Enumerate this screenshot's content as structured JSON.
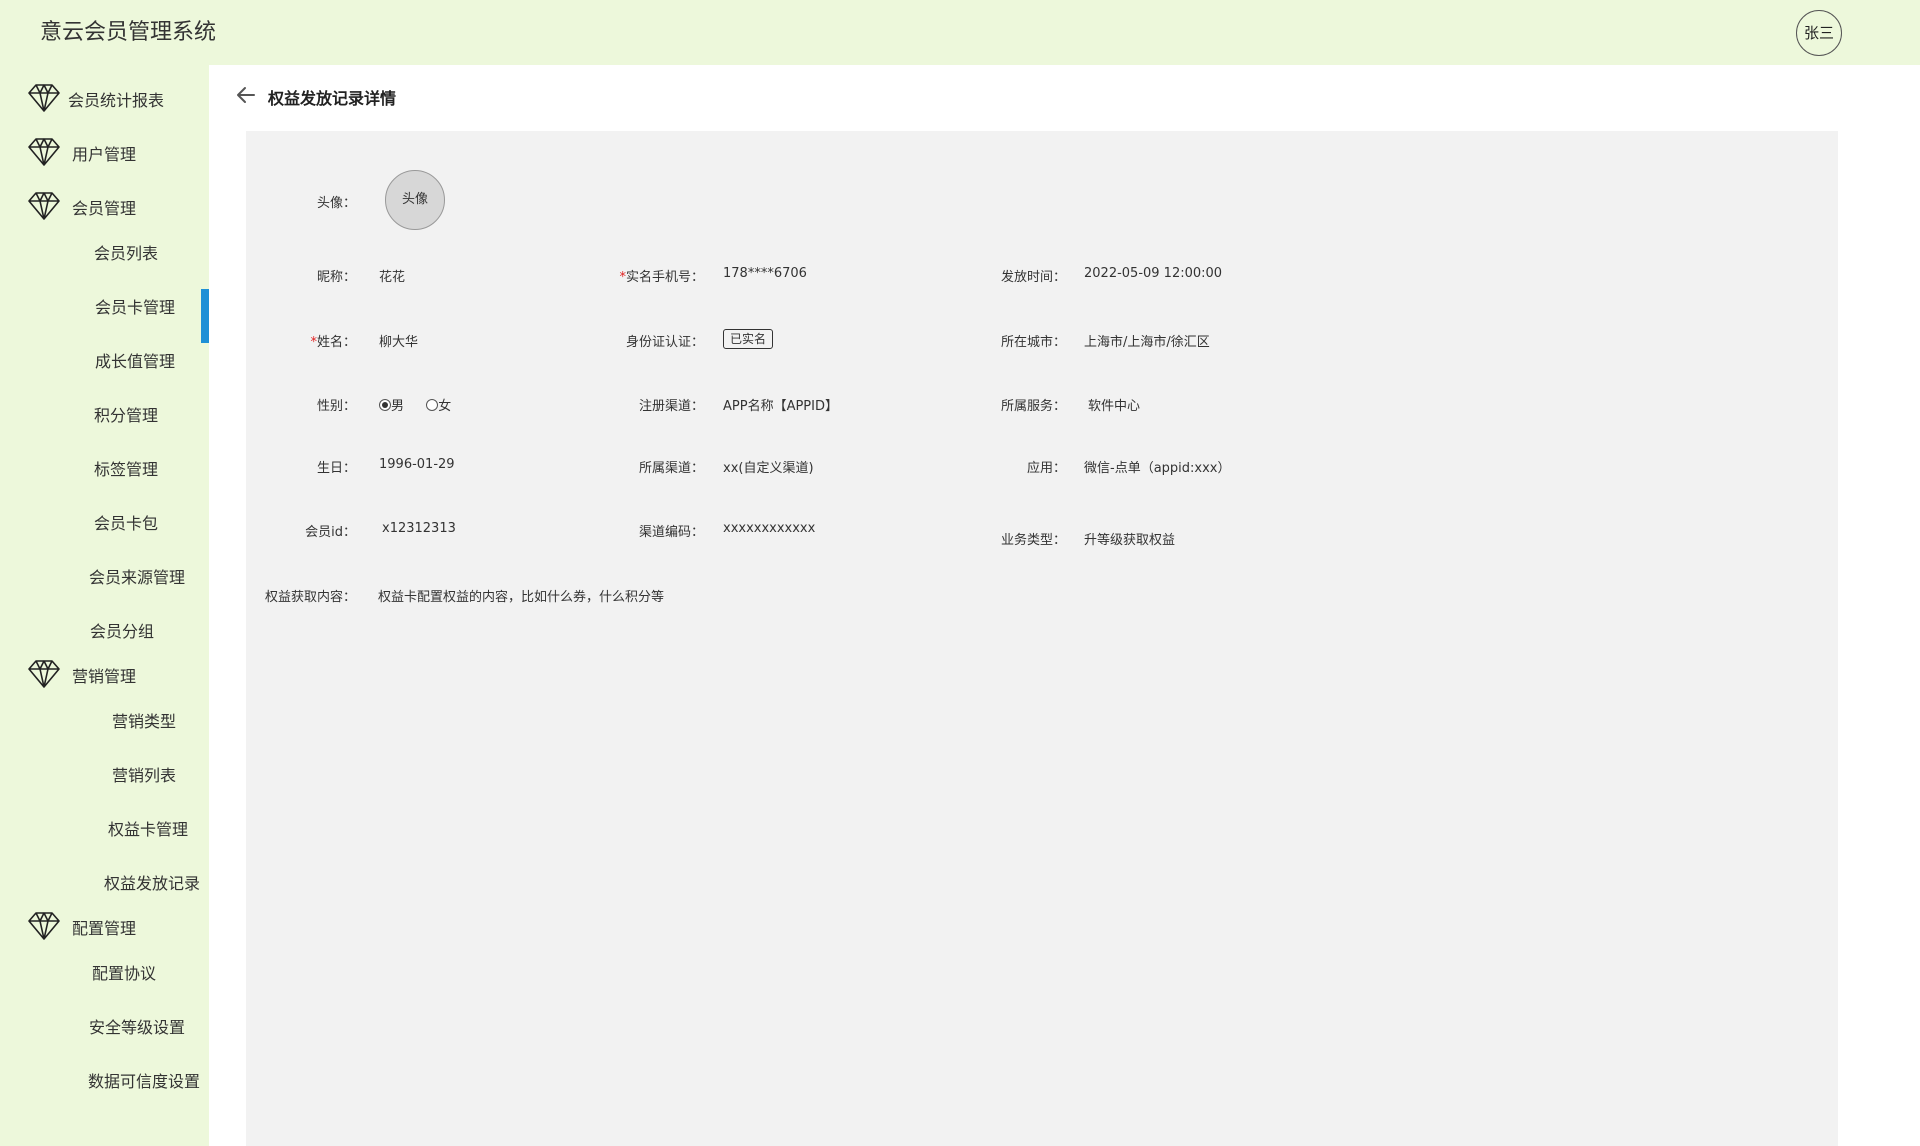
{
  "app": {
    "title": "意云会员管理系统",
    "user": "张三"
  },
  "sidebar": {
    "groups": [
      {
        "label": "会员统计报表"
      },
      {
        "label": "用户管理"
      },
      {
        "label": "会员管理",
        "items": [
          "会员列表",
          "会员卡管理",
          "成长值管理",
          "积分管理",
          "标签管理",
          "会员卡包",
          "会员来源管理",
          "会员分组"
        ]
      },
      {
        "label": "营销管理",
        "items": [
          "营销类型",
          "营销列表",
          "权益卡管理",
          "权益发放记录"
        ]
      },
      {
        "label": "配置管理",
        "items": [
          "配置协议",
          "安全等级设置",
          "数据可信度设置"
        ]
      }
    ],
    "active_item": "会员列表"
  },
  "page": {
    "title": "权益发放记录详情"
  },
  "detail": {
    "avatar": {
      "label": "头像：",
      "value": "头像"
    },
    "nickname": {
      "label": "昵称：",
      "value": "花花"
    },
    "phone": {
      "required": "*",
      "label": "实名手机号：",
      "value": "178****6706"
    },
    "issue_time": {
      "label": "发放时间：",
      "value": "2022-05-09 12:00:00"
    },
    "name": {
      "required": "*",
      "label": "姓名：",
      "value": "柳大华"
    },
    "id_auth": {
      "label": "身份证认证：",
      "value": "已实名"
    },
    "city": {
      "label": "所在城市：",
      "value": "上海市/上海市/徐汇区"
    },
    "gender": {
      "label": "性别：",
      "options": [
        "男",
        "女"
      ],
      "selected": "男"
    },
    "reg_channel": {
      "label": "注册渠道：",
      "value": "APP名称【APPID】"
    },
    "service": {
      "label": "所属服务：",
      "value": "软件中心"
    },
    "birthday": {
      "label": "生日：",
      "value": "1996-01-29"
    },
    "channel": {
      "label": "所属渠道：",
      "value": "xx(自定义渠道)"
    },
    "app_name": {
      "label": "应用：",
      "value": "微信-点单（appid:xxx）"
    },
    "member_id": {
      "label": "会员id：",
      "value": "x12312313"
    },
    "channel_code": {
      "label": "渠道编码：",
      "value": "xxxxxxxxxxxx"
    },
    "biz_type": {
      "label": "业务类型：",
      "value": "升等级获取权益"
    },
    "benefit_content": {
      "label": "权益获取内容：",
      "value": "权益卡配置权益的内容，比如什么券，什么积分等"
    }
  }
}
